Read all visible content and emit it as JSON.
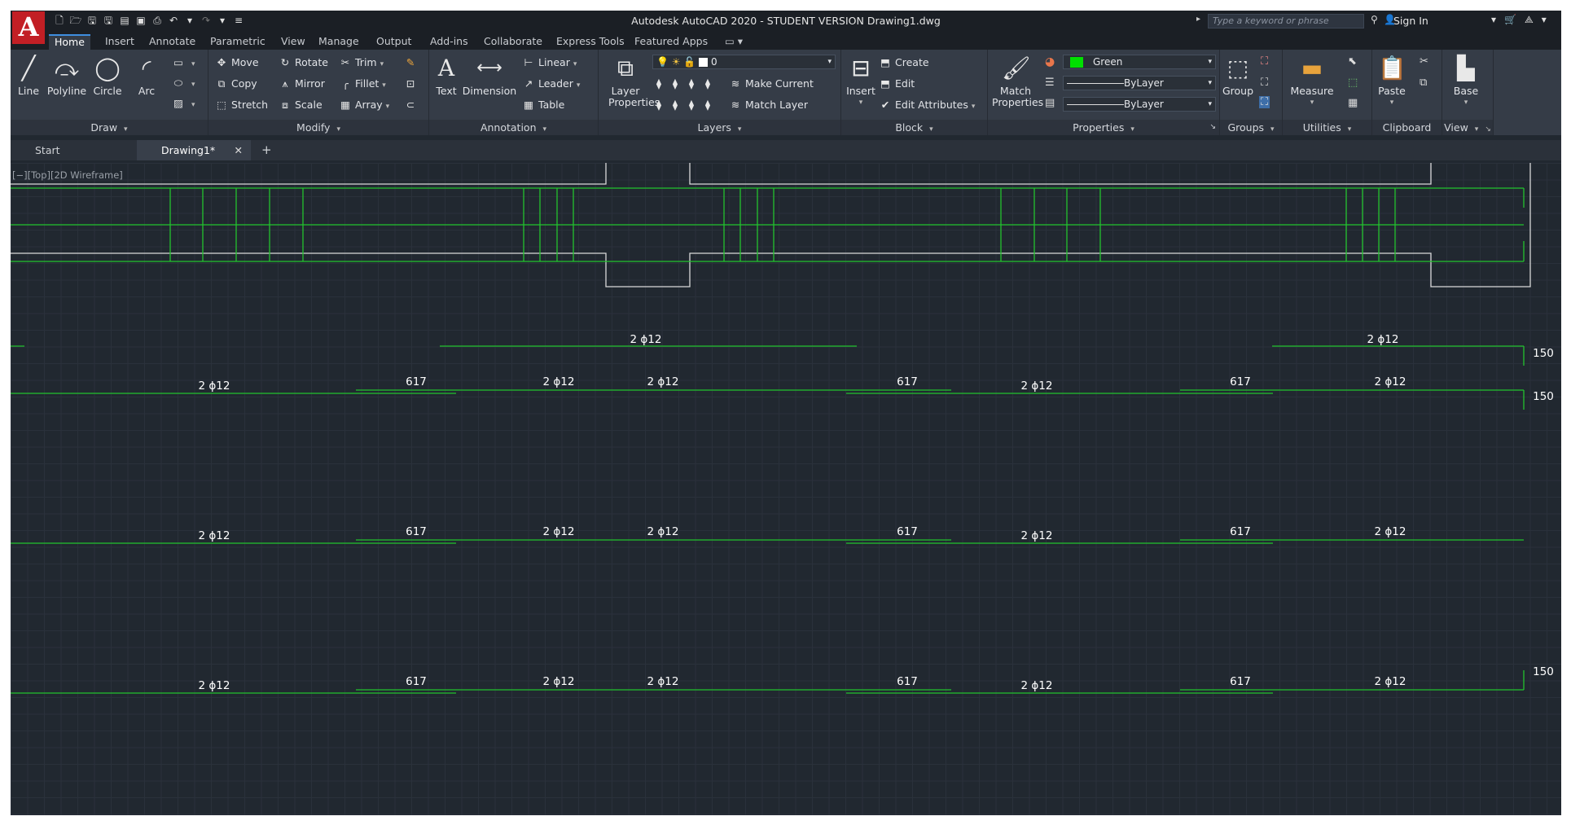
{
  "app": {
    "logo": "A",
    "title": "Autodesk AutoCAD 2020 - STUDENT VERSION    Drawing1.dwg",
    "search_placeholder": "Type a keyword or phrase",
    "sign_in": "Sign In"
  },
  "ribbon_tabs": [
    "Home",
    "Insert",
    "Annotate",
    "Parametric",
    "View",
    "Manage",
    "Output",
    "Add-ins",
    "Collaborate",
    "Express Tools",
    "Featured Apps"
  ],
  "draw": {
    "label": "Draw",
    "line": "Line",
    "polyline": "Polyline",
    "circle": "Circle",
    "arc": "Arc"
  },
  "modify": {
    "label": "Modify",
    "move": "Move",
    "rotate": "Rotate",
    "trim": "Trim",
    "copy": "Copy",
    "mirror": "Mirror",
    "fillet": "Fillet",
    "stretch": "Stretch",
    "scale": "Scale",
    "array": "Array"
  },
  "annotation": {
    "label": "Annotation",
    "text": "Text",
    "dimension": "Dimension",
    "linear": "Linear",
    "leader": "Leader",
    "table": "Table"
  },
  "layers": {
    "label": "Layers",
    "layer_properties": "Layer Properties",
    "current_layer": "0",
    "make_current": "Make Current",
    "match_layer": "Match Layer"
  },
  "block": {
    "label": "Block",
    "insert": "Insert",
    "create": "Create",
    "edit": "Edit",
    "edit_attributes": "Edit Attributes"
  },
  "properties": {
    "label": "Properties",
    "match_properties": "Match Properties",
    "color": "Green",
    "linetype": "ByLayer",
    "lineweight": "ByLayer",
    "color_hex": "#00e000"
  },
  "groups": {
    "label": "Groups",
    "group": "Group"
  },
  "utilities": {
    "label": "Utilities",
    "measure": "Measure"
  },
  "clipboard": {
    "label": "Clipboard",
    "paste": "Paste"
  },
  "view": {
    "label": "View",
    "base": "Base"
  },
  "file_tabs": {
    "start": "Start",
    "drawing": "Drawing1*",
    "close": "✕",
    "add": "+"
  },
  "viewport_label": "[−][Top][2D Wireframe]",
  "drawing_labels": {
    "bar": "2 ϕ12",
    "length": "617",
    "hook": "150"
  },
  "colors": {
    "canvas": "#212830",
    "geometry": "#22c32e",
    "outline": "#d9d9d9",
    "brand": "#c21f25"
  }
}
